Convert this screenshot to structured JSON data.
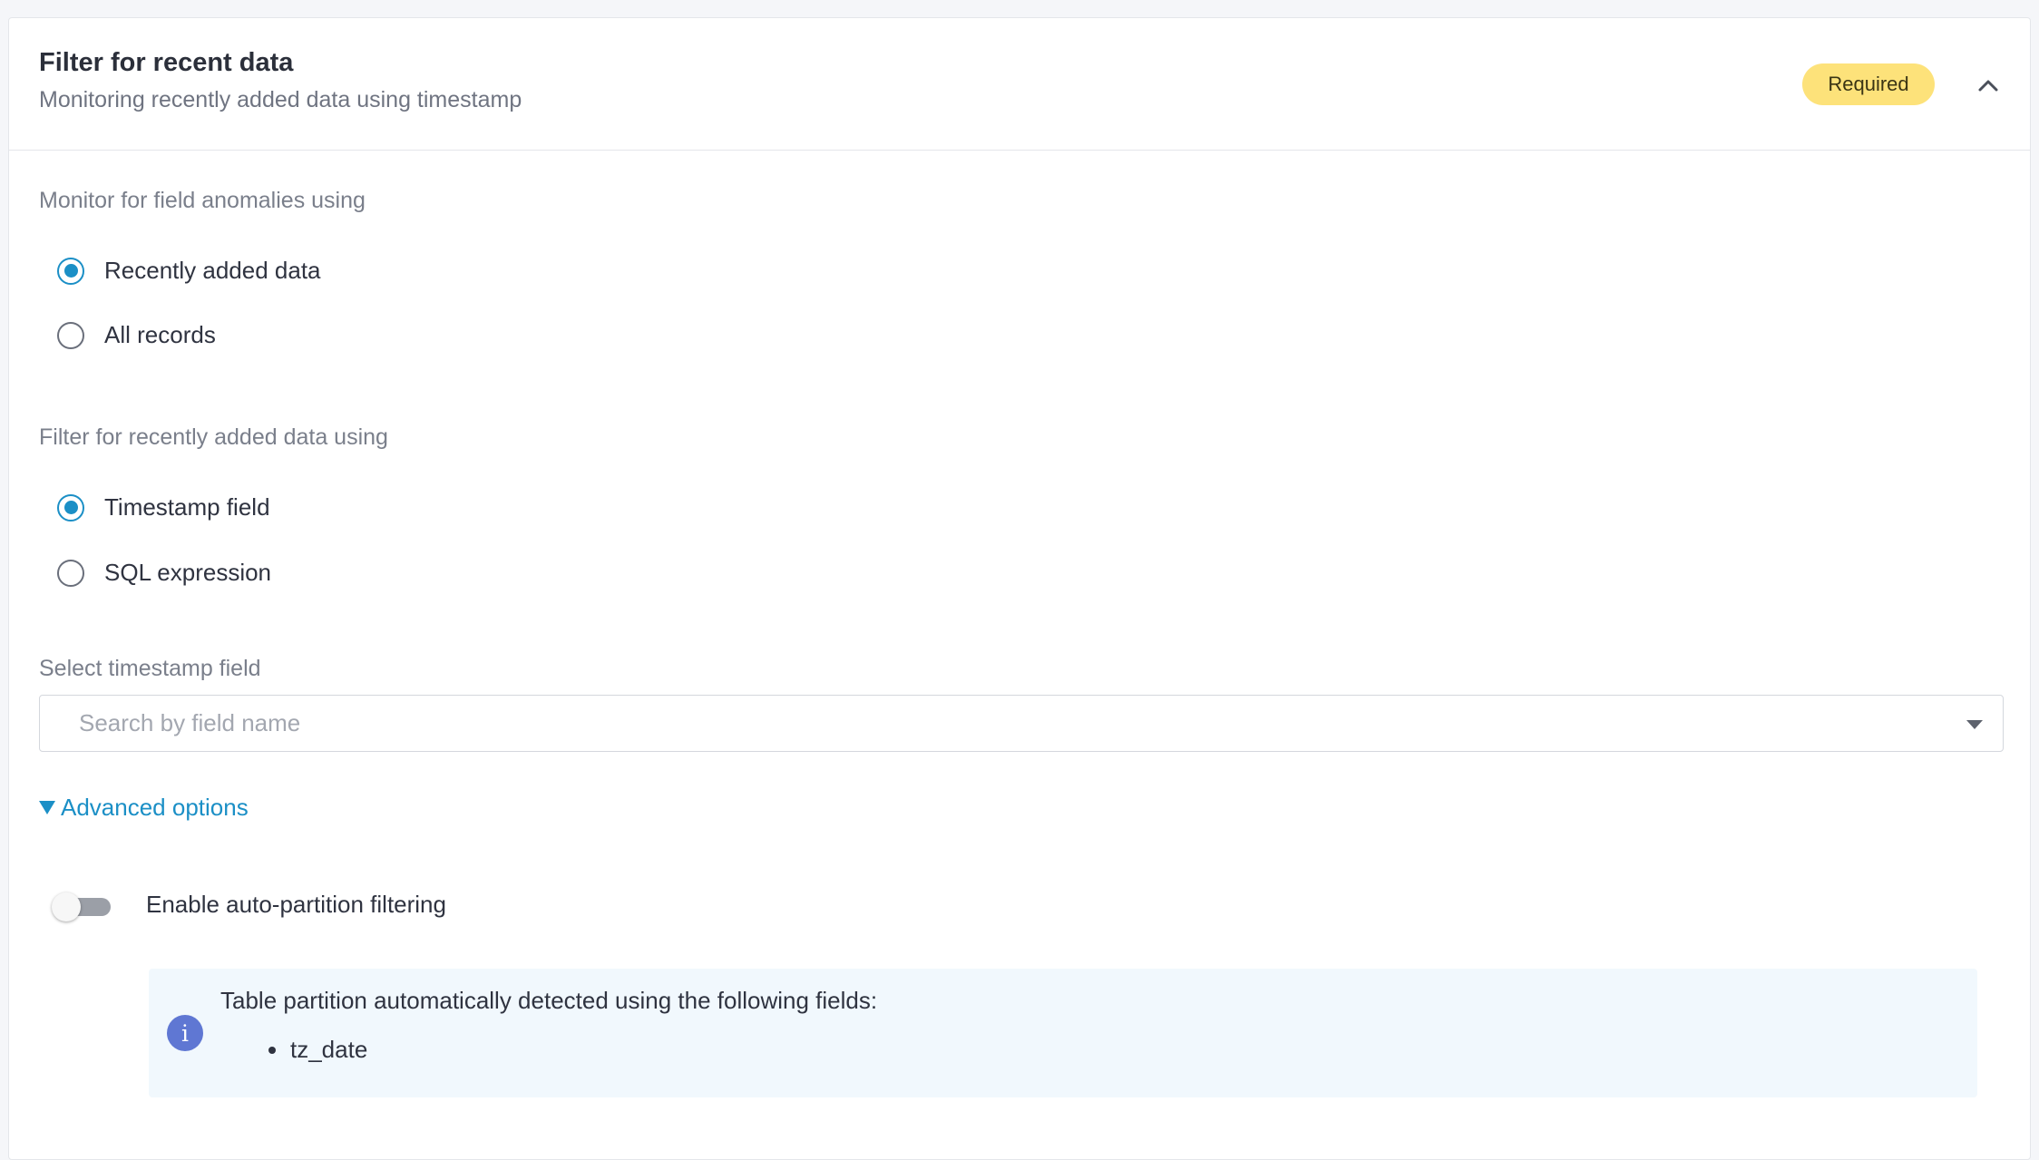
{
  "header": {
    "title": "Filter for recent data",
    "subtitle": "Monitoring recently added data using timestamp",
    "badge": "Required"
  },
  "monitor_section": {
    "label": "Monitor for field anomalies using",
    "options": [
      {
        "label": "Recently added data",
        "checked": true
      },
      {
        "label": "All records",
        "checked": false
      }
    ]
  },
  "filter_section": {
    "label": "Filter for recently added data using",
    "options": [
      {
        "label": "Timestamp field",
        "checked": true
      },
      {
        "label": "SQL expression",
        "checked": false
      }
    ]
  },
  "timestamp_field": {
    "label": "Select timestamp field",
    "placeholder": "Search by field name",
    "value": ""
  },
  "advanced": {
    "label": "Advanced options",
    "expanded": true,
    "auto_partition": {
      "label": "Enable auto-partition filtering",
      "enabled": false
    },
    "info": {
      "text": "Table partition automatically detected using the following fields:",
      "fields": [
        "tz_date"
      ]
    }
  },
  "icons": {
    "collapse": "chevron-up-icon",
    "dropdown": "caret-down-icon",
    "advanced_toggle": "triangle-down-icon",
    "info": "info-icon"
  },
  "colors": {
    "accent": "#1b8fc6",
    "badge_bg": "#fde27a",
    "info_bg": "#f1f8fd",
    "info_icon": "#5f77d3"
  }
}
